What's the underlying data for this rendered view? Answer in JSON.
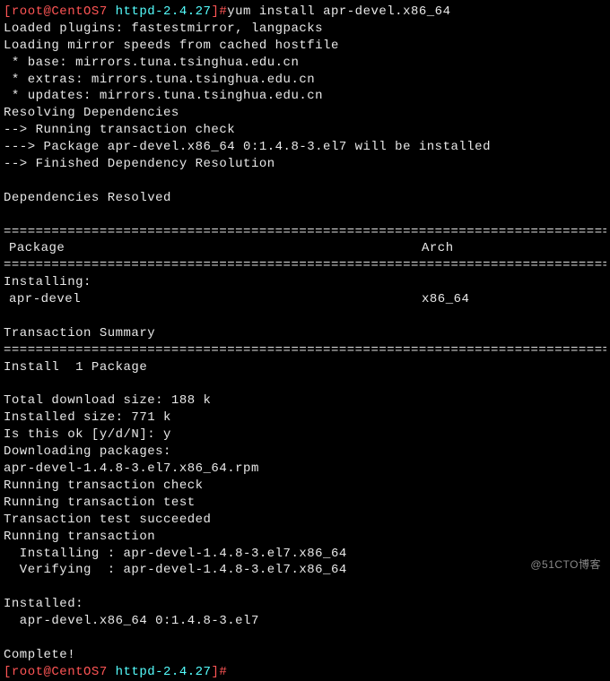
{
  "prompt1": {
    "user_host": "[root@CentOS7",
    "dir": " httpd-2.4.27",
    "sep": "]#",
    "cmd": "yum install apr-devel.x86_64"
  },
  "loaded_plugins": "Loaded plugins: fastestmirror, langpacks",
  "loading_mirror": "Loading mirror speeds from cached hostfile",
  "mirror_base": " * base: mirrors.tuna.tsinghua.edu.cn",
  "mirror_extras": " * extras: mirrors.tuna.tsinghua.edu.cn",
  "mirror_updates": " * updates: mirrors.tuna.tsinghua.edu.cn",
  "resolving": "Resolving Dependencies",
  "running_check": "--> Running transaction check",
  "pkg_line": "---> Package apr-devel.x86_64 0:1.4.8-3.el7 will be installed",
  "finished": "--> Finished Dependency Resolution",
  "deps_resolved": "Dependencies Resolved",
  "hr": "================================================================================",
  "hdr_package": " Package",
  "hdr_arch": "Arch",
  "installing_label": "Installing:",
  "row_pkg": " apr-devel",
  "row_arch": "x86_64",
  "tx_summary": "Transaction Summary",
  "install_count": "Install  1 Package",
  "dl_size": "Total download size: 188 k",
  "inst_size": "Installed size: 771 k",
  "confirm": "Is this ok [y/d/N]: y",
  "downloading": "Downloading packages:",
  "rpm_file": "apr-devel-1.4.8-3.el7.x86_64.rpm",
  "run_check": "Running transaction check",
  "run_test": "Running transaction test",
  "test_ok": "Transaction test succeeded",
  "run_tx": "Running transaction",
  "installing_pkg": "  Installing : apr-devel-1.4.8-3.el7.x86_64",
  "verifying_pkg": "  Verifying  : apr-devel-1.4.8-3.el7.x86_64",
  "installed_label": "Installed:",
  "installed_pkg": "  apr-devel.x86_64 0:1.4.8-3.el7",
  "complete": "Complete!",
  "prompt2": {
    "user_host": "[root@CentOS7",
    "dir": " httpd-2.4.27",
    "sep": "]#"
  },
  "watermark": "@51CTO博客"
}
